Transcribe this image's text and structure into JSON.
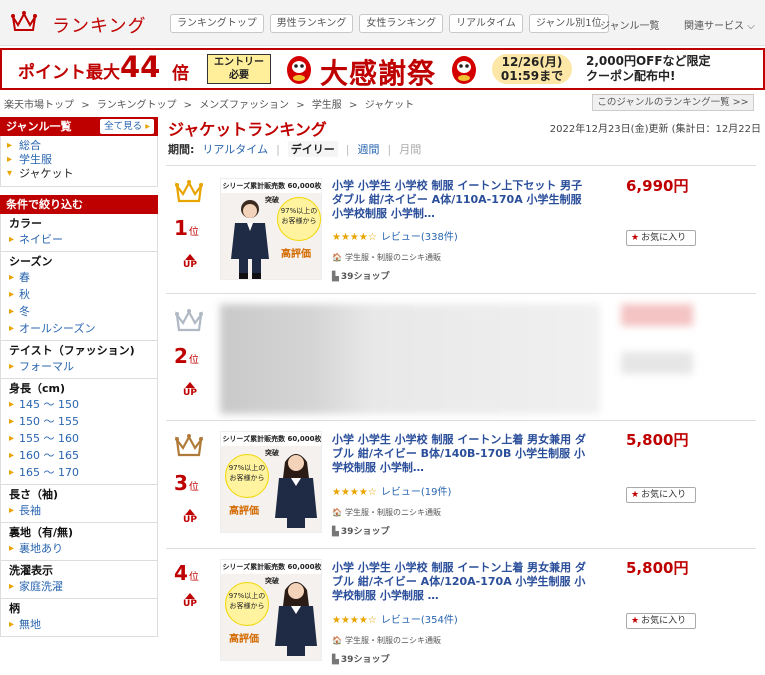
{
  "header": {
    "logo_text": "ランキング",
    "nav": [
      "ランキングトップ",
      "男性ランキング",
      "女性ランキング",
      "リアルタイム",
      "ジャンル別1位"
    ],
    "genre_link": "ジャンル一覧",
    "related_services": "関連サービス"
  },
  "banner": {
    "point_text": "ポイント最大",
    "multiplier": "44",
    "multiplier_unit": "倍",
    "entry_line1": "エントリー",
    "entry_line2": "必要",
    "event_name": "大感謝祭",
    "deadline_line1": "12/26(月)",
    "deadline_line2": "01:59まで",
    "coupon_line1": "2,000円OFFなど限定",
    "coupon_line2": "クーポン配布中!"
  },
  "breadcrumb": [
    "楽天市場トップ",
    ">",
    "ランキングトップ",
    ">",
    "メンズファッション",
    ">",
    "学生服",
    ">",
    "ジャケット"
  ],
  "genre_ranking_list_link": "このジャンルのランキング一覧 >>",
  "sidebar": {
    "genre_header": "ジャンル一覧",
    "all_button": "全て見る",
    "genres": [
      "総合",
      "学生服",
      "ジャケット"
    ],
    "filter_header": "条件で絞り込む",
    "filters": [
      {
        "title": "カラー",
        "options": [
          "ネイビー"
        ]
      },
      {
        "title": "シーズン",
        "options": [
          "春",
          "秋",
          "冬",
          "オールシーズン"
        ]
      },
      {
        "title": "テイスト（ファッション)",
        "options": [
          "フォーマル"
        ]
      },
      {
        "title": "身長（cm)",
        "options": [
          "145 ～ 150",
          "150 ～ 155",
          "155 ～ 160",
          "160 ～ 165",
          "165 ～ 170"
        ]
      },
      {
        "title": "長さ（袖)",
        "options": [
          "長袖"
        ]
      },
      {
        "title": "裏地（有/無)",
        "options": [
          "裏地あり"
        ]
      },
      {
        "title": "洗濯表示",
        "options": [
          "家庭洗濯"
        ]
      },
      {
        "title": "柄",
        "options": [
          "無地"
        ]
      }
    ]
  },
  "main": {
    "title": "ジャケットランキング",
    "updated": "2022年12月23日(金)更新 (集計日：12月22日",
    "period_label": "期間:",
    "periods": [
      "リアルタイム",
      "|",
      "デイリー",
      "|",
      "週間",
      "|",
      "月間"
    ]
  },
  "items": [
    {
      "rank": "1",
      "rank_suffix": "位",
      "up": "UP",
      "title": "小学 小学生 小学校 制服 イートン上下セット 男子 ダブル 紺/ネイビー A体/110A-170A 小学生制服 小学校制服 小学制…",
      "stars": "★★★★☆",
      "review_label": "レビュー",
      "review_count": "(338件)",
      "shop": "学生服・制服のニシキ通販",
      "shop2": "39ショップ",
      "price": "6,990円",
      "fav": "お気に入り",
      "thumb_band": "シリーズ累計販売数 60,000枚突破",
      "thumb_circle": "97%以上の お客様から",
      "thumb_badge": "高評価"
    },
    {
      "rank": "2",
      "rank_suffix": "位",
      "up": "UP"
    },
    {
      "rank": "3",
      "rank_suffix": "位",
      "up": "UP",
      "title": "小学 小学生 小学校 制服 イートン上着 男女兼用 ダブル 紺/ネイビー B体/140B-170B 小学生制服 小学校制服 小学制…",
      "stars": "★★★★☆",
      "review_label": "レビュー",
      "review_count": "(19件)",
      "shop": "学生服・制服のニシキ通販",
      "shop2": "39ショップ",
      "price": "5,800円",
      "fav": "お気に入り",
      "thumb_band": "シリーズ累計販売数 60,000枚突破",
      "thumb_circle": "97%以上の お客様から",
      "thumb_badge": "高評価"
    },
    {
      "rank": "4",
      "rank_suffix": "位",
      "up": "UP",
      "title": "小学 小学生 小学校 制服 イートン上着 男女兼用 ダブル 紺/ネイビー A体/120A-170A 小学生制服 小学校制服 小学制服 …",
      "stars": "★★★★☆",
      "review_label": "レビュー",
      "review_count": "(354件)",
      "shop": "学生服・制服のニシキ通販",
      "shop2": "39ショップ",
      "price": "5,800円",
      "fav": "お気に入り",
      "thumb_band": "シリーズ累計販売数 60,000枚突破",
      "thumb_circle": "97%以上の お客様から",
      "thumb_badge": "高評価"
    }
  ],
  "colors": {
    "accent": "#bf0000",
    "link": "#2a66b0",
    "gold": "#e8a400",
    "silver": "#b0b8c4",
    "bronze": "#b07a3a"
  }
}
